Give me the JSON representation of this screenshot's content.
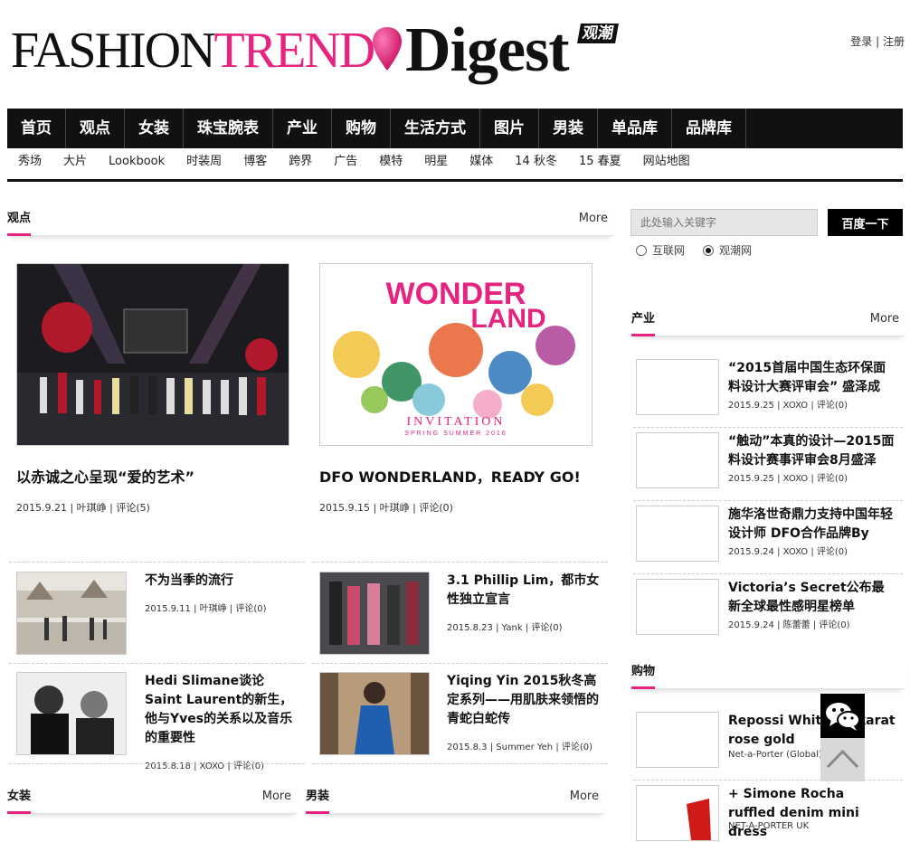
{
  "header": {
    "logo_fashion": "FASHION",
    "logo_trend": "TREND",
    "logo_digest": "Digest",
    "logo_badge": "观潮",
    "login": "登录",
    "register": "注册",
    "separator": "|"
  },
  "nav": [
    "首页",
    "观点",
    "女装",
    "珠宝腕表",
    "产业",
    "购物",
    "生活方式",
    "图片",
    "男装",
    "单品库",
    "品牌库"
  ],
  "subnav": [
    "秀场",
    "大片",
    "Lookbook",
    "时装周",
    "博客",
    "跨界",
    "广告",
    "模特",
    "明星",
    "媒体",
    "14 秋冬",
    "15 春夏",
    "网站地图"
  ],
  "sections": {
    "guandian": {
      "title": "观点",
      "more": "More"
    },
    "nvzhuang": {
      "title": "女装",
      "more": "More"
    },
    "nanzhuang": {
      "title": "男装",
      "more": "More"
    },
    "chanye": {
      "title": "产业",
      "more": "More"
    },
    "gouwu": {
      "title": "购物"
    }
  },
  "features": [
    {
      "title": "以赤诚之心呈现“爱的艺术”",
      "meta": "2015.9.21 | 叶琪峥 | 评论(5)"
    },
    {
      "title": "DFO WONDERLAND，READY GO!",
      "meta": "2015.9.15 | 叶琪峥 | 评论(0)",
      "image_text_1": "WONDER",
      "image_text_2": "LAND",
      "image_text_3": "INVITATION",
      "image_text_4": "SPRING SUMMER 2016"
    }
  ],
  "articles": [
    {
      "title": "不为当季的流行",
      "meta": "2015.9.11 | 叶琪峥 | 评论(0)"
    },
    {
      "title": "3.1 Phillip Lim，都市女性独立宣言",
      "meta": "2015.8.23 | Yank | 评论(0)"
    },
    {
      "title": "Hedi Slimane谈论Saint Laurent的新生，他与Yves的关系以及音乐的重要性",
      "meta": "2015.8.18 | XOXO | 评论(0)"
    },
    {
      "title": "Yiqing Yin 2015秋冬高定系列——用肌肤来领悟的青蛇白蛇传",
      "meta": "2015.8.3 | Summer Yeh | 评论(0)"
    }
  ],
  "search": {
    "placeholder": "此处输入关键字",
    "button": "百度一下",
    "option_1": "互联网",
    "option_2": "观潮网"
  },
  "chanye_items": [
    {
      "title": "“2015首届中国生态环保面料设计大赛评审会” 盛泽成",
      "meta": "2015.9.25 | XOXO | 评论(0)"
    },
    {
      "title": "“触动”本真的设计—2015面料设计赛事评审会8月盛泽",
      "meta": "2015.9.25 | XOXO | 评论(0)"
    },
    {
      "title": "施华洛世奇鼎力支持中国年轻设计师 DFO合作品牌By",
      "meta": "2015.9.24 | XOXO | 评论(0)"
    },
    {
      "title": "Victoria’s Secret公布最新全球最性感明星榜单",
      "meta": "2015.9.24 | 陈蕾蕾 | 评论(0)"
    }
  ],
  "gouwu_items": [
    {
      "title": "Repossi White 18-karat rose gold",
      "meta": "Net-a-Porter (Global)"
    },
    {
      "title": "+ Simone Rocha ruffled denim mini dress",
      "meta": "NET-A-PORTER UK"
    }
  ],
  "colors": {
    "accent": "#e6237f",
    "nav_bg": "#111111"
  }
}
